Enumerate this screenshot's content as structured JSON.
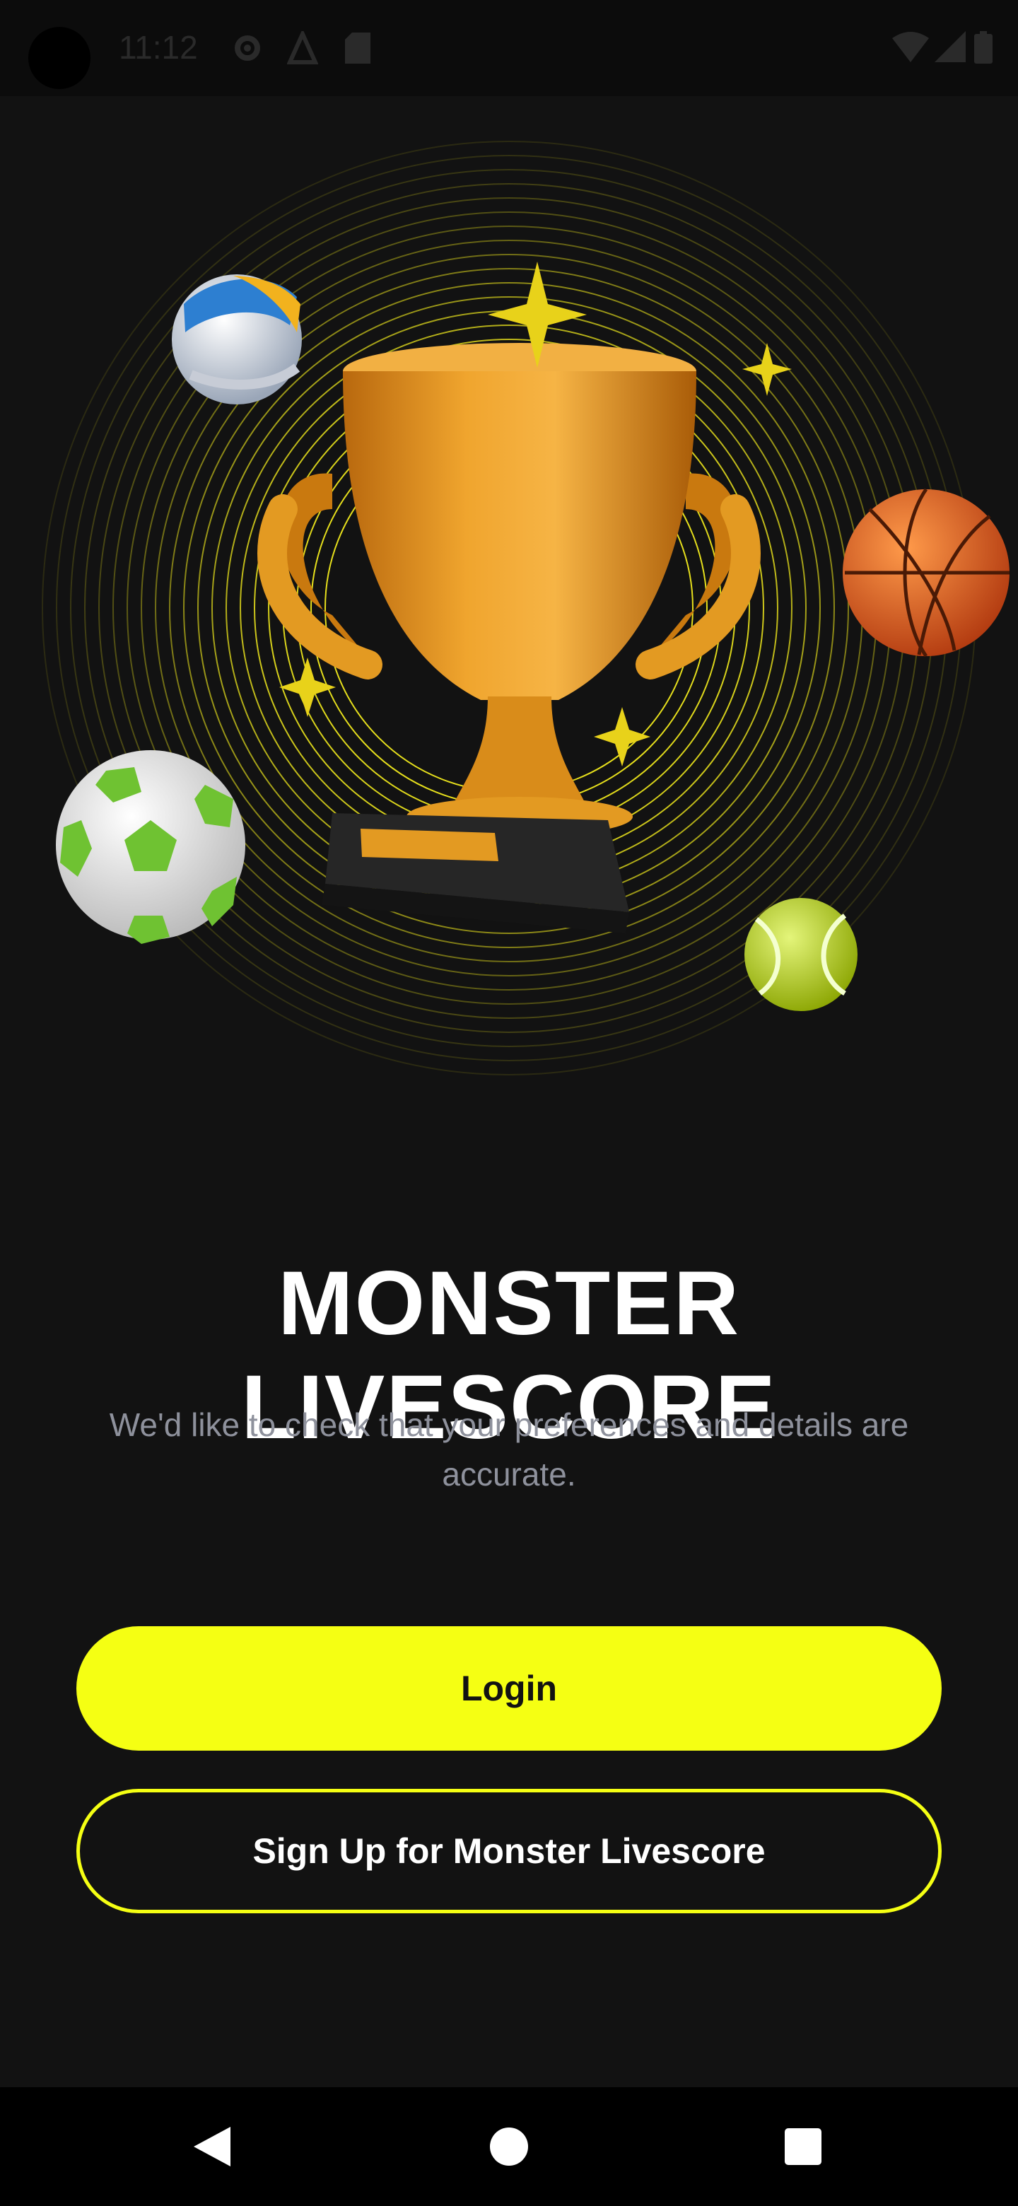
{
  "status_bar": {
    "time": "11:12",
    "icons": [
      "settings-icon",
      "notification-icon",
      "sim-card-icon",
      "wifi-icon",
      "signal-icon",
      "battery-icon"
    ]
  },
  "hero": {
    "image": "trophy-with-sports-balls-illustration",
    "items": [
      "trophy-icon",
      "volleyball-icon",
      "basketball-icon",
      "soccer-ball-icon",
      "tennis-ball-icon",
      "sparkle-icon"
    ]
  },
  "app_title": "MONSTER LIVESCORE",
  "subtitle": "We'd like to check that your preferences and details are accurate.",
  "buttons": {
    "login": "Login",
    "signup": "Sign Up for Monster Livescore"
  },
  "nav_bar": {
    "icons": [
      "back-icon",
      "home-icon",
      "recents-icon"
    ]
  },
  "colors": {
    "background": "#121212",
    "accent": "#f5ff13",
    "title": "#ffffff",
    "subtitle": "#8e919c",
    "trophy": "#e89a1e"
  }
}
